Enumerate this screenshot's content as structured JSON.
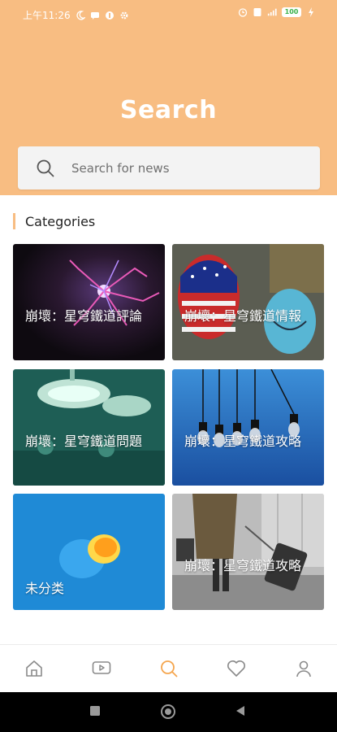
{
  "status_bar": {
    "time": "上午11:26",
    "battery": "100"
  },
  "header": {
    "title": "Search"
  },
  "search": {
    "placeholder": "Search for news"
  },
  "categories": {
    "heading": "Categories",
    "items": [
      {
        "label": "崩壞：星穹鐵道評論",
        "image": "plasma-ball"
      },
      {
        "label": "崩壞：星穹鐵道情報",
        "image": "masks"
      },
      {
        "label": "崩壞：星穹鐵道問題",
        "image": "surgery-lights"
      },
      {
        "label": "崩壞：星穹鐵道攻略",
        "image": "hanging-bulbs"
      },
      {
        "label": "未分类",
        "image": "blue-orange-fruit"
      },
      {
        "label": "崩壞：星穹鐵道攻略",
        "image": "traveler-luggage"
      }
    ]
  },
  "bottom_nav": {
    "items": [
      {
        "icon": "home-icon",
        "active": false
      },
      {
        "icon": "video-icon",
        "active": false
      },
      {
        "icon": "search-icon",
        "active": true
      },
      {
        "icon": "heart-icon",
        "active": false
      },
      {
        "icon": "profile-icon",
        "active": false
      }
    ]
  },
  "colors": {
    "accent": "#f8bd82",
    "active_nav": "#f5a64e",
    "inactive_nav": "#8a8a8a"
  }
}
